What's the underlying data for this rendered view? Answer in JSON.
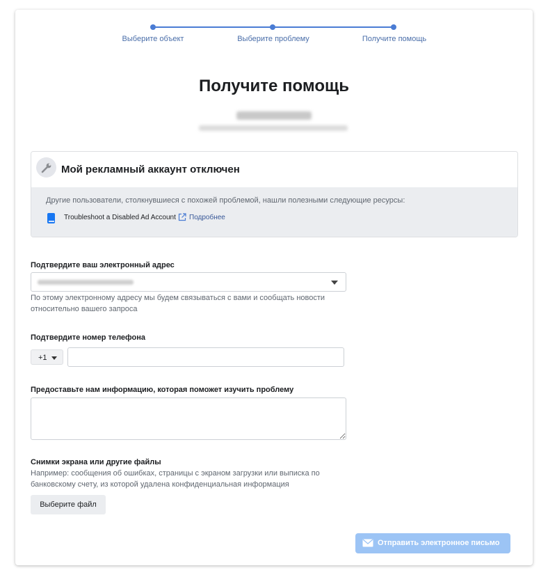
{
  "stepper": {
    "steps": [
      "Выберите объект",
      "Выберите проблему",
      "Получите помощь"
    ]
  },
  "page": {
    "title": "Получите помощь"
  },
  "issue": {
    "title": "Мой рекламный аккаунт отключен",
    "hint": "Другие пользователи, столкнувшиеся с похожей проблемой, нашли полезными следующие ресурсы:",
    "resource_title": "Troubleshoot a Disabled Ad Account",
    "resource_link": "Подробнее"
  },
  "form": {
    "email_label": "Подтвердите ваш электронный адрес",
    "email_help": "По этому электронному адресу мы будем связываться с вами и сообщать новости относительно вашего запроса",
    "phone_label": "Подтвердите номер телефона",
    "country_code": "+1",
    "phone_value": "",
    "info_label": "Предоставьте нам информацию, которая поможет изучить проблему",
    "info_value": "",
    "files_label": "Снимки экрана или другие файлы",
    "files_help": "Например: сообщения об ошибках, страницы с экраном загрузки или выписка по банковскому счету, из которой удалена конфиденциальная информация",
    "file_button": "Выберите файл",
    "submit_button": "Отправить электронное письмо"
  },
  "colors": {
    "accent": "#4a7cd4",
    "link": "#385898",
    "submit_disabled": "#9cc4f5"
  },
  "icons": {
    "issue_icon": "wrench-icon",
    "resource_icon": "book-icon",
    "link_icon": "external-link-icon",
    "submit_icon": "envelope-icon"
  }
}
